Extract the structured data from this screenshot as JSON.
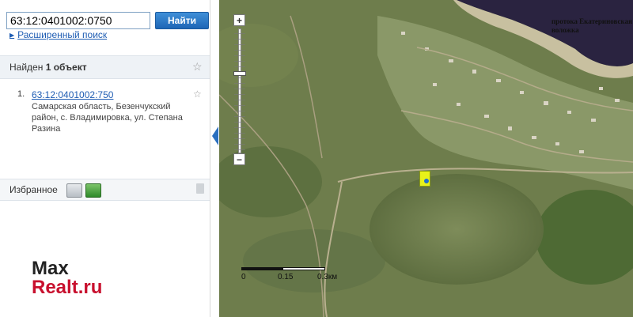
{
  "search": {
    "value": "63:12:0401002:0750",
    "button_label": "Найти",
    "advanced_label": "Расширенный поиск"
  },
  "results": {
    "found_prefix": "Найден ",
    "found_count": "1 объект",
    "items": [
      {
        "number": "1.",
        "cadastral": "63:12:0401002:750",
        "address": "Самарская область, Безенчукский район, с. Владимировка, ул. Степана Разина"
      }
    ]
  },
  "favorites": {
    "label": "Избранное"
  },
  "map": {
    "zoom_in": "+",
    "zoom_out": "−",
    "label": "протока Екатериновская воложка",
    "scale": [
      "0",
      "0.15",
      "0.3км"
    ]
  },
  "watermark": {
    "line1": "Max",
    "line2": "Realt.ru"
  }
}
